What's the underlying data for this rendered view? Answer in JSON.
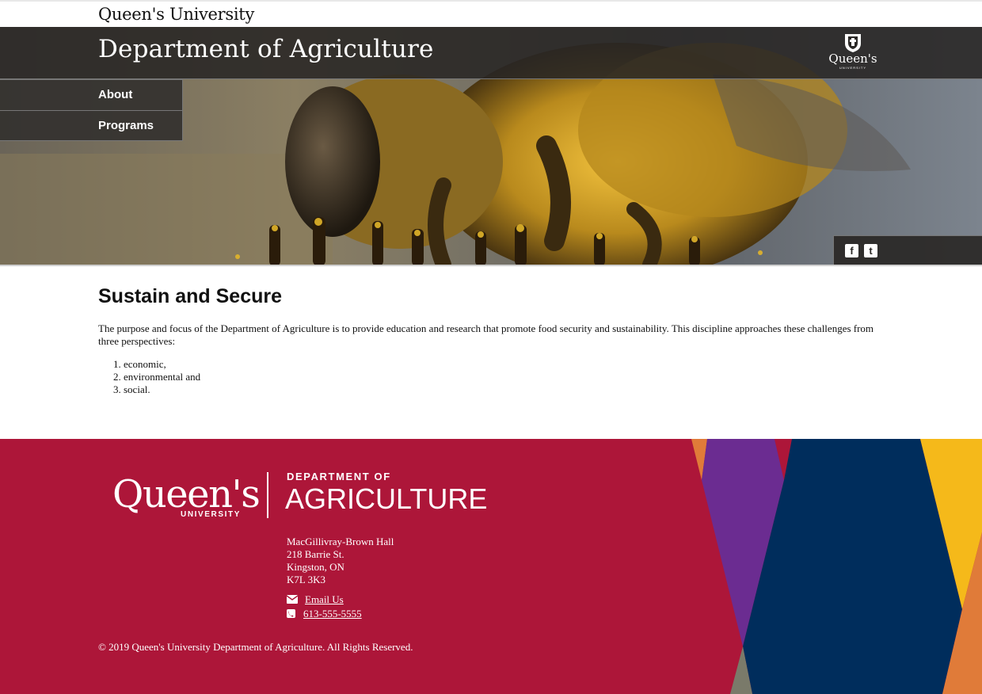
{
  "site": {
    "university_name": "Queen's University"
  },
  "header": {
    "department_title": "Department of Agriculture",
    "crest_wordmark": "Queen's",
    "crest_subtext": "UNIVERSITY"
  },
  "nav": {
    "items": [
      {
        "label": "About"
      },
      {
        "label": "Programs"
      }
    ]
  },
  "social": {
    "facebook_glyph": "f",
    "twitter_glyph": "t"
  },
  "main": {
    "heading": "Sustain and Secure",
    "intro": "The purpose and focus of the Department of Agriculture is to provide education and research that promote food security and sustainability. This discipline approaches these challenges from three perspectives:",
    "perspectives": [
      "economic,",
      "environmental and",
      "social."
    ]
  },
  "footer": {
    "logo_queens": "Queen's",
    "logo_university": "UNIVERSITY",
    "logo_department_of": "DEPARTMENT OF",
    "logo_agriculture": "AGRICULTURE",
    "address_lines": [
      "MacGillivray-Brown Hall",
      "218 Barrie St.",
      "Kingston, ON",
      "K7L 3K3"
    ],
    "email_label": "Email Us",
    "phone_label": "613-555-5555",
    "copyright": "© 2019 Queen's University Department of Agriculture. All Rights Reserved."
  },
  "colors": {
    "footer_red": "#ad1639",
    "deco_orange": "#e07b39",
    "deco_purple": "#6b2c91",
    "deco_navy": "#002d5c",
    "deco_gold": "#f5b91a",
    "hero_overlay": "#282624"
  },
  "icons": [
    "queens-crest-icon",
    "facebook-icon",
    "twitter-icon",
    "envelope-icon",
    "phone-icon"
  ]
}
